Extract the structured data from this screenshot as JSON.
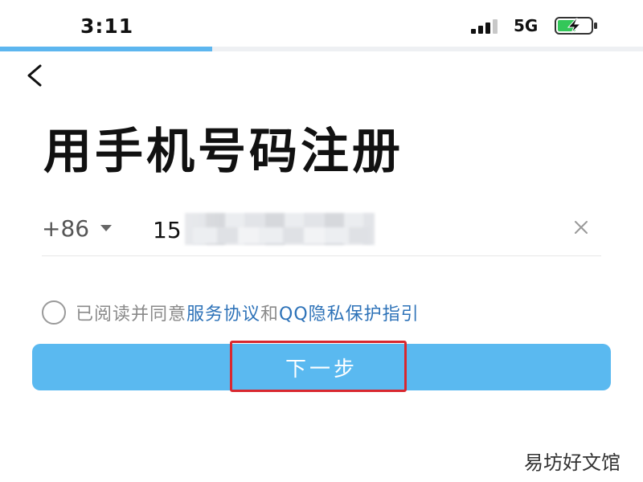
{
  "status_bar": {
    "time": "3:11",
    "network": "5G",
    "signal_icon": "signal-bars-icon",
    "battery_icon": "battery-charging-icon",
    "battery_color": "#33c759"
  },
  "progress": {
    "fraction": 0.33,
    "color": "#5db6ef"
  },
  "header": {
    "back_icon": "chevron-left-icon"
  },
  "title": "用手机号码注册",
  "phone_form": {
    "country_code": "+86",
    "country_dropdown_icon": "caret-down-icon",
    "phone_value": "15",
    "clear_icon": "close-icon"
  },
  "agreement": {
    "prefix": "已阅读并同意",
    "terms_link": "服务协议",
    "conjunction": "和",
    "privacy_link": "QQ隐私保护指引",
    "link_color": "#2d72b8"
  },
  "next_button": {
    "label": "下一步",
    "color": "#5ab9f0"
  },
  "annotation": {
    "highlight_color": "#d9282f"
  },
  "watermark": "易坊好文馆"
}
